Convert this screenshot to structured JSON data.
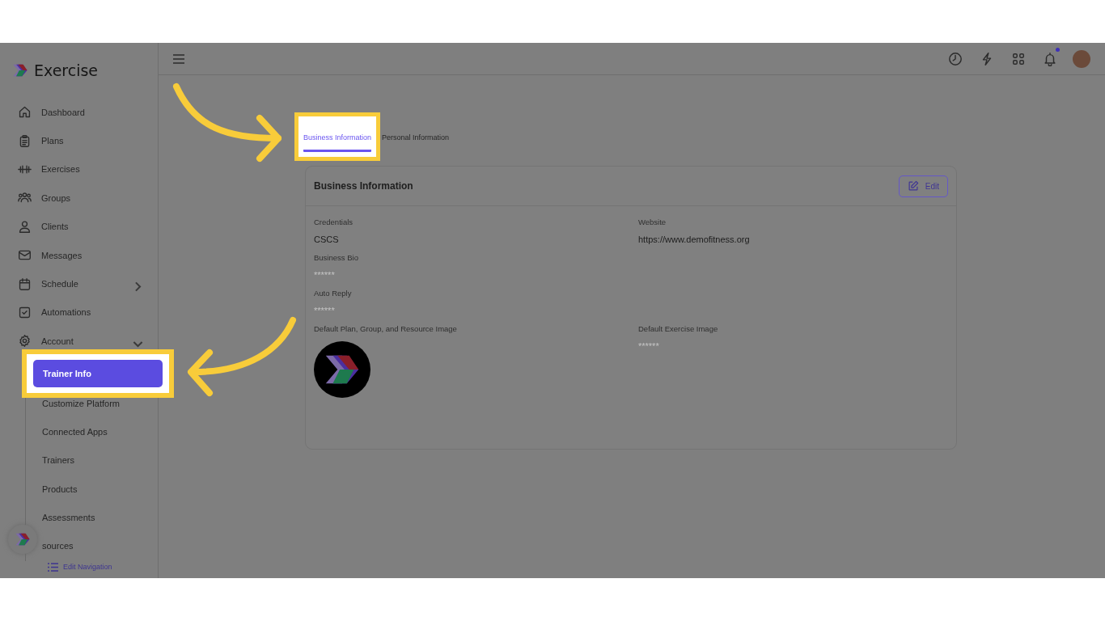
{
  "brand": {
    "name": "Exercise"
  },
  "sidebar": {
    "items": [
      {
        "label": "Dashboard",
        "kind": "link"
      },
      {
        "label": "Plans",
        "kind": "link"
      },
      {
        "label": "Exercises",
        "kind": "link"
      },
      {
        "label": "Groups",
        "kind": "link"
      },
      {
        "label": "Clients",
        "kind": "link"
      },
      {
        "label": "Messages",
        "kind": "link"
      },
      {
        "label": "Schedule",
        "kind": "group",
        "expanded": false
      },
      {
        "label": "Automations",
        "kind": "link"
      },
      {
        "label": "Account",
        "kind": "group",
        "expanded": true,
        "children": [
          {
            "label": "Trainer Info",
            "selected": true,
            "highlighted": true
          },
          {
            "label": "Customize Platform",
            "selected": false,
            "highlighted": false
          },
          {
            "label": "Connected Apps",
            "selected": false,
            "highlighted": false
          },
          {
            "label": "Trainers",
            "selected": false,
            "highlighted": false
          },
          {
            "label": "Products",
            "selected": false,
            "highlighted": false
          },
          {
            "label": "Assessments",
            "selected": false,
            "highlighted": false
          },
          {
            "label": "sources",
            "selected": false,
            "highlighted": false
          }
        ]
      }
    ],
    "edit_link": "Edit Navigation"
  },
  "topbar": {
    "notification_unread": true
  },
  "tabs": [
    {
      "label": "Business Information",
      "selected": true,
      "highlighted": true
    },
    {
      "label": "Personal Information",
      "selected": false,
      "highlighted": false
    }
  ],
  "card": {
    "title": "Business Information",
    "button": "Edit",
    "rows": [
      [
        {
          "label": "Credentials",
          "kind": "text",
          "value": "CSCS"
        },
        {
          "label": "Website",
          "kind": "text",
          "value": "https://www.demofitness.org"
        }
      ],
      [
        {
          "label": "Business Bio",
          "kind": "masked",
          "value": "******"
        }
      ],
      [
        {
          "label": "Auto Reply",
          "kind": "masked",
          "value": "******"
        }
      ],
      [
        {
          "label": "Default Plan, Group, and Resource Image",
          "kind": "image"
        },
        {
          "label": "Default Exercise Image",
          "kind": "masked",
          "value": "******"
        }
      ]
    ]
  }
}
